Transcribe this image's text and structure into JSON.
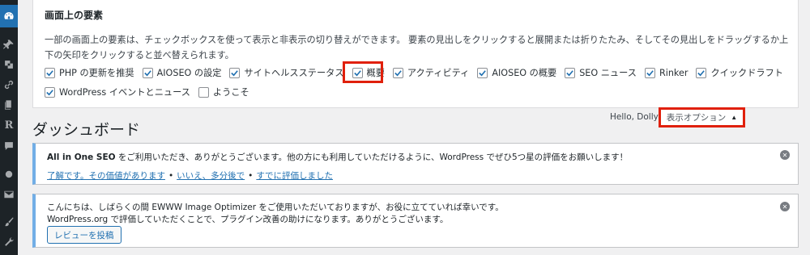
{
  "sidebar": {
    "icons": [
      "dashboard-icon",
      "pin-icon",
      "media-icon",
      "link-icon",
      "pages-icon",
      "rinker-icon",
      "comments-icon",
      "circle-icon",
      "mail-icon",
      "brush-icon",
      "tools-icon"
    ],
    "rinker_letter": "R"
  },
  "screen_options": {
    "heading": "画面上の要素",
    "description": "一部の画面上の要素は、チェックボックスを使って表示と非表示の切り替えができます。 要素の見出しをクリックすると展開または折りたたみ、そしてその見出しをドラッグするか上下の矢印をクリックすると並べ替えられます。",
    "row1": [
      {
        "label": "PHP の更新を推奨",
        "checked": true
      },
      {
        "label": "AIOSEO の設定",
        "checked": true
      },
      {
        "label": "サイトヘルスステータス",
        "checked": true
      },
      {
        "label": "概要",
        "checked": true
      },
      {
        "label": "アクティビティ",
        "checked": true
      },
      {
        "label": "AIOSEO の概要",
        "checked": true
      },
      {
        "label": "SEO ニュース",
        "checked": true
      },
      {
        "label": "Rinker",
        "checked": true
      },
      {
        "label": "クイックドラフト",
        "checked": true
      }
    ],
    "row2": [
      {
        "label": "WordPress イベントとニュース",
        "checked": true
      },
      {
        "label": "ようこそ",
        "checked": false
      }
    ]
  },
  "header": {
    "page_title": "ダッシュボード",
    "hello": "Hello, Dolly",
    "screen_options_label": "表示オプション",
    "arrow": "▲"
  },
  "notice1": {
    "text_bold": "All in One SEO",
    "text_rest": " をご利用いただき、ありがとうございます。他の方にも利用していただけるように、WordPress でぜひ5つ星の評価をお願いします！",
    "links": [
      "了解です。その価値があります",
      "いいえ、多分後で",
      "すでに評価しました"
    ],
    "separator": "•"
  },
  "notice2": {
    "line1": "こんにちは、しばらくの間 EWWW Image Optimizer をご使用いただいておりますが、お役に立てていれば幸いです。",
    "line2": "WordPress.org で評価していただくことで、プラグイン改善の助けになります。ありがとうございます。",
    "button": "レビューを投稿"
  },
  "colors": {
    "sidebar_bg": "#1d2327",
    "accent": "#2271b1",
    "highlight": "#e0200b",
    "notice_border": "#72aee6"
  }
}
